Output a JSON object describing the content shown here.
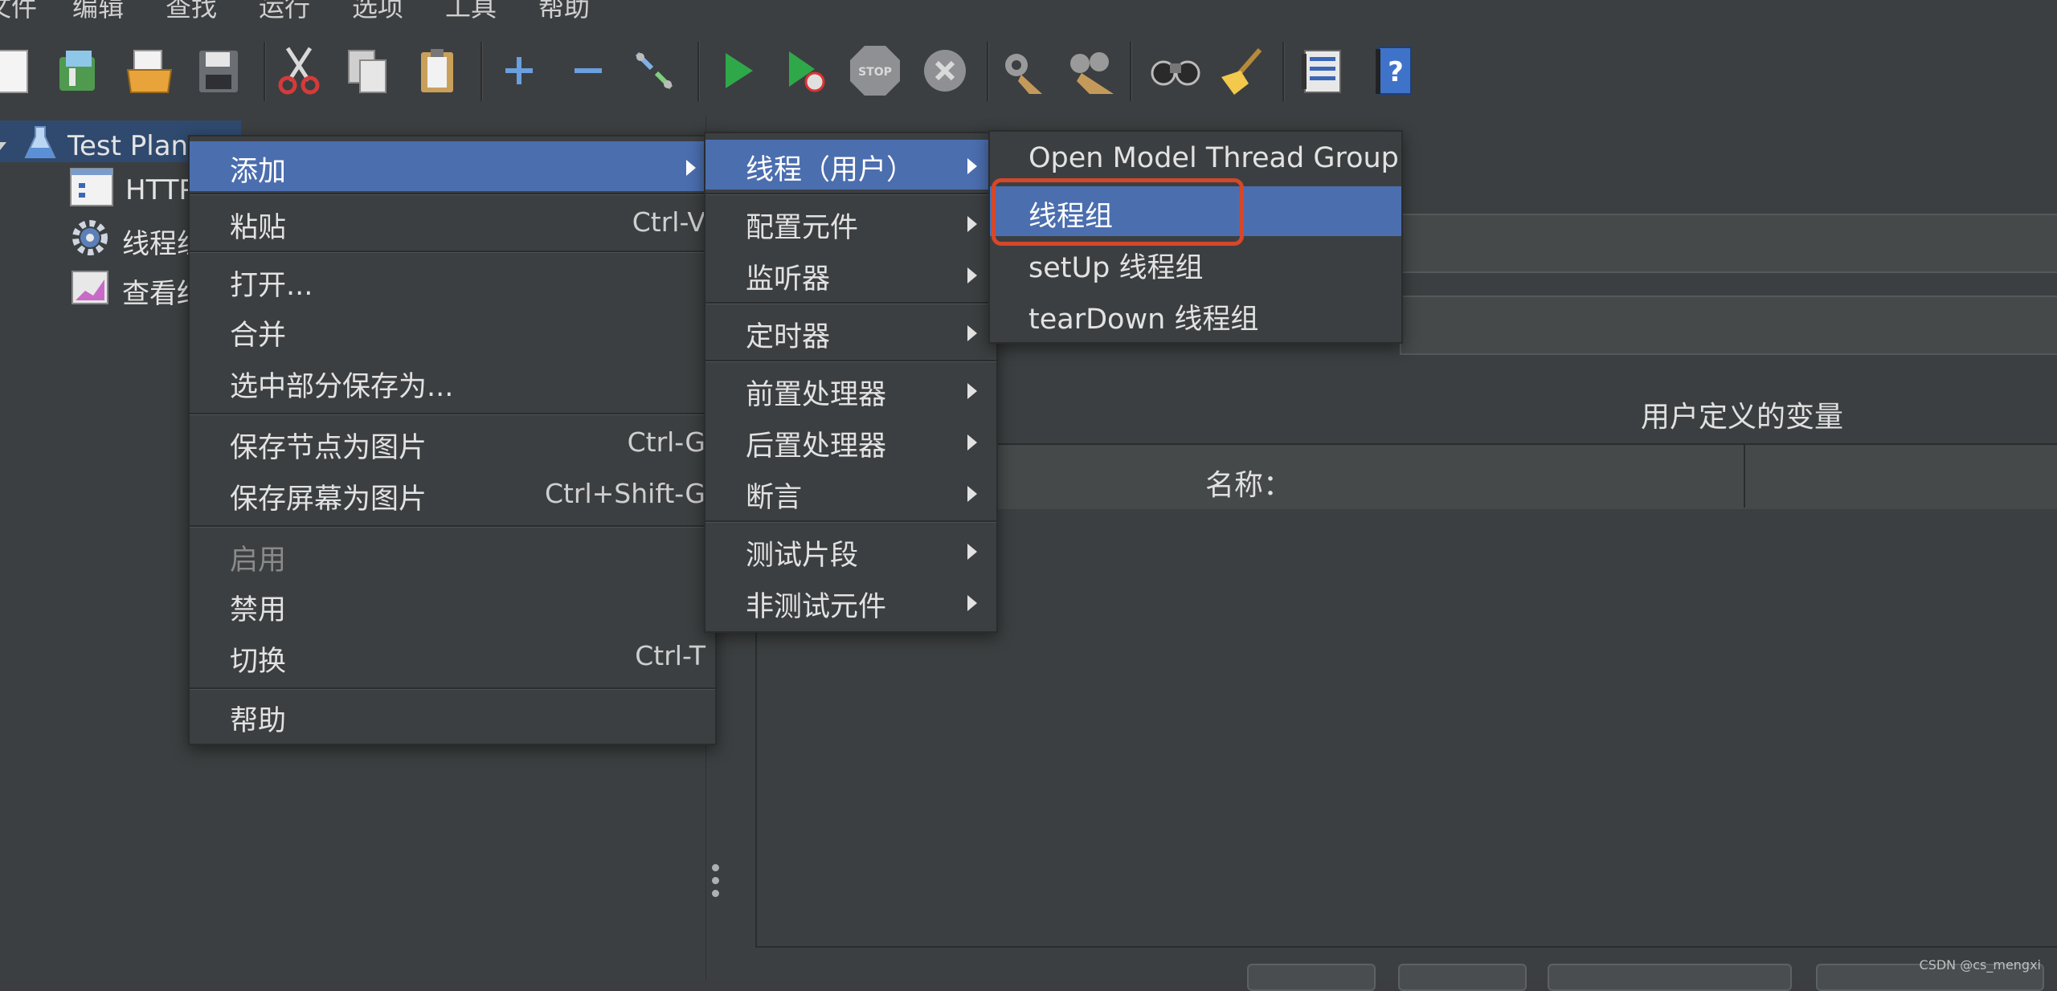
{
  "menubar": {
    "items": [
      "文件",
      "编辑",
      "查找",
      "运行",
      "选项",
      "工具",
      "帮助"
    ]
  },
  "toolbar": {
    "icons": [
      "new-icon",
      "templates-icon",
      "open-icon",
      "save-icon",
      "cut-icon",
      "copy-icon",
      "paste-icon",
      "expand-icon",
      "collapse-icon",
      "toggle-icon",
      "start-icon",
      "start-no-pause-icon",
      "stop-icon",
      "shutdown-icon",
      "clear-icon",
      "clear-all-icon",
      "search-icon",
      "reset-search-icon",
      "function-helper-icon",
      "help-icon"
    ]
  },
  "tree": {
    "items": [
      {
        "label": "Test Plan"
      },
      {
        "label": "HTTP"
      },
      {
        "label": "线程组"
      },
      {
        "label": "查看结果树"
      }
    ]
  },
  "context_menu": {
    "add": "添加",
    "paste": "粘贴",
    "paste_shortcut": "Ctrl-V",
    "open": "打开...",
    "merge": "合并",
    "save_selection_as": "选中部分保存为...",
    "save_node_as_image": "保存节点为图片",
    "save_node_shortcut": "Ctrl-G",
    "save_screen_as_image": "保存屏幕为图片",
    "save_screen_shortcut": "Ctrl+Shift-G",
    "enable": "启用",
    "disable": "禁用",
    "toggle": "切换",
    "toggle_shortcut": "Ctrl-T",
    "help": "帮助"
  },
  "add_submenu": {
    "threads": "线程（用户）",
    "config": "配置元件",
    "listener": "监听器",
    "timer": "定时器",
    "pre_processor": "前置处理器",
    "post_processor": "后置处理器",
    "assertion": "断言",
    "test_fragment": "测试片段",
    "non_test": "非测试元件"
  },
  "threads_submenu": {
    "open_model": "Open Model Thread Group",
    "thread_group": "线程组",
    "setup": "setUp 线程组",
    "teardown": "tearDown 线程组"
  },
  "right_panel": {
    "variables_title": "用户定义的变量",
    "name_header": "名称："
  },
  "watermark": "CSDN @cs_mengxi",
  "colors": {
    "highlight": "#4b6eaf",
    "annotation_box": "#d6472a",
    "background": "#3c3f41"
  }
}
